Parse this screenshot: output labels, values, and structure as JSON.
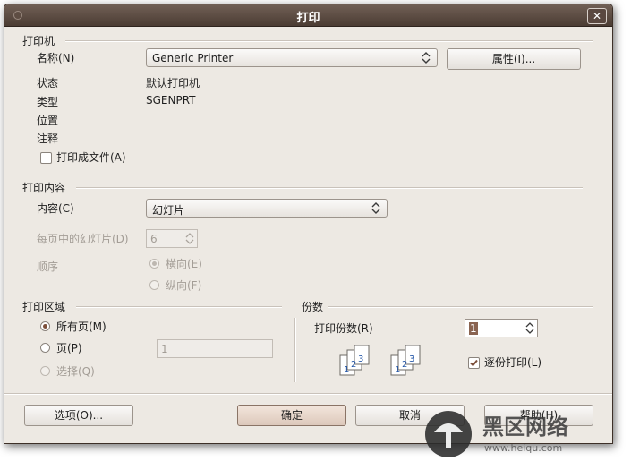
{
  "window": {
    "title": "打印",
    "close_label": "✕"
  },
  "printer": {
    "section_label": "打印机",
    "name_label": "名称(N)",
    "name_value": "Generic Printer",
    "properties_button": "属性(I)...",
    "status_label": "状态",
    "status_value": "默认打印机",
    "type_label": "类型",
    "type_value": "SGENPRT",
    "location_label": "位置",
    "comment_label": "注释",
    "print_to_file_label": "打印成文件(A)",
    "print_to_file_checked": false
  },
  "content": {
    "section_label": "打印内容",
    "content_label": "内容(C)",
    "content_value": "幻灯片",
    "slides_per_page_label": "每页中的幻灯片(D)",
    "slides_per_page_value": "6",
    "order_label": "顺序",
    "order_options": [
      "横向(E)",
      "纵向(F)"
    ],
    "order_selected": 0
  },
  "range": {
    "section_label": "打印区域",
    "all_pages_label": "所有页(M)",
    "pages_label": "页(P)",
    "pages_value": "1",
    "selection_label": "选择(Q)",
    "selected": "all"
  },
  "copies": {
    "section_label": "份数",
    "count_label": "打印份数(R)",
    "count_value": "1",
    "collate_label": "逐份打印(L)",
    "collate_checked": true,
    "collate_icon_numbers": [
      "1",
      "2",
      "3"
    ]
  },
  "buttons": {
    "options": "选项(O)...",
    "ok": "确定",
    "cancel": "取消",
    "help": "帮助(H)"
  },
  "watermark": {
    "text": "黑区网络",
    "url": "www.heiqu.com"
  },
  "colors": {
    "titlebar": "#5a4a40",
    "dialog_bg": "#ede9e3",
    "accent": "#7c4f3a"
  }
}
